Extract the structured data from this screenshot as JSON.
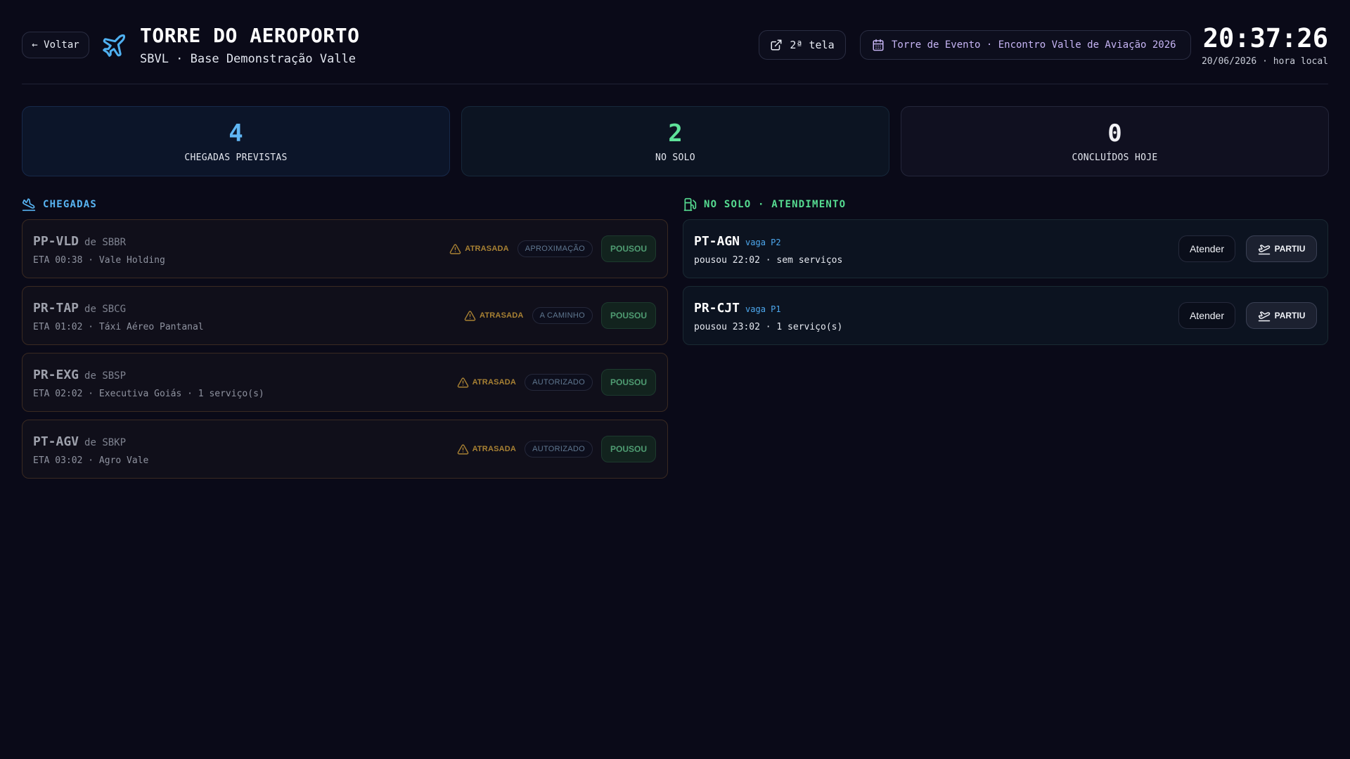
{
  "header": {
    "back_label": "← Voltar",
    "title": "TORRE DO AEROPORTO",
    "subtitle": "SBVL · Base Demonstração Valle",
    "second_screen_label": "2ª tela",
    "event_label": "Torre de Evento · Encontro Valle de Aviação 2026",
    "clock": "20:37:26",
    "date_line": "20/06/2026 · hora local"
  },
  "stats": [
    {
      "value": "4",
      "label": "CHEGADAS PREVISTAS"
    },
    {
      "value": "2",
      "label": "NO SOLO"
    },
    {
      "value": "0",
      "label": "CONCLUÍDOS HOJE"
    }
  ],
  "sections": {
    "arrivals_title": "CHEGADAS",
    "ground_title": "NO SOLO · ATENDIMENTO"
  },
  "arrivals": [
    {
      "reg": "PP-VLD",
      "origin": "de SBBR",
      "meta": "ETA 00:38 · Vale Holding",
      "late": "ATRASADA",
      "phase": "APROXIMAÇÃO",
      "action": "POUSOU"
    },
    {
      "reg": "PR-TAP",
      "origin": "de SBCG",
      "meta": "ETA 01:02 · Táxi Aéreo Pantanal",
      "late": "ATRASADA",
      "phase": "A CAMINHO",
      "action": "POUSOU"
    },
    {
      "reg": "PR-EXG",
      "origin": "de SBSP",
      "meta": "ETA 02:02 · Executiva Goiás · 1 serviço(s)",
      "late": "ATRASADA",
      "phase": "AUTORIZADO",
      "action": "POUSOU"
    },
    {
      "reg": "PT-AGV",
      "origin": "de SBKP",
      "meta": "ETA 03:02 · Agro Vale",
      "late": "ATRASADA",
      "phase": "AUTORIZADO",
      "action": "POUSOU"
    }
  ],
  "ground": [
    {
      "reg": "PT-AGN",
      "spot": "vaga P2",
      "meta": "pousou 22:02 · sem serviços",
      "serve": "Atender",
      "depart": "PARTIU"
    },
    {
      "reg": "PR-CJT",
      "spot": "vaga P1",
      "meta": "pousou 23:02 · 1 serviço(s)",
      "serve": "Atender",
      "depart": "PARTIU"
    }
  ],
  "icons": {
    "logo": "airplane-icon",
    "second_screen": "external-link-icon",
    "event": "calendar-icon",
    "arrivals": "plane-landing-icon",
    "ground": "fuel-pump-icon",
    "late": "warning-triangle-icon",
    "depart": "plane-takeoff-icon"
  },
  "colors": {
    "background": "#0a0a18",
    "accent_blue": "#58b4f2",
    "accent_green": "#56dc91",
    "late_amber": "#a88133",
    "event_purple": "#c7b5f5"
  }
}
